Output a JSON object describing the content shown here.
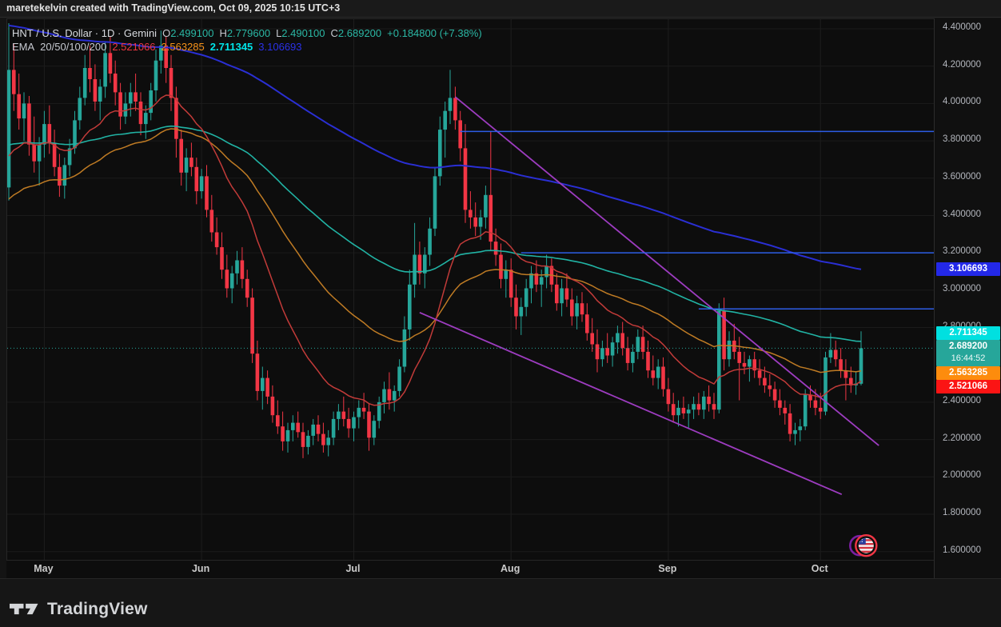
{
  "topbar": {
    "text": "maretekelvin created with TradingView.com, Oct 09, 2025 10:15 UTC+3"
  },
  "legend": {
    "symbol": "HNT / U.S. Dollar · 1D · Gemini",
    "ohlc": [
      {
        "label": "O",
        "value": "2.499100"
      },
      {
        "label": "H",
        "value": "2.779600"
      },
      {
        "label": "L",
        "value": "2.490100"
      },
      {
        "label": "C",
        "value": "2.689200"
      }
    ],
    "change": "+0.184800 (+7.38%)",
    "ema_label": "EMA",
    "ema_periods": "20/50/100/200",
    "ema_values": [
      {
        "text": "2.521066",
        "color": "#ef3742"
      },
      {
        "text": "2.563285",
        "color": "#f7931a"
      },
      {
        "text": "2.711345",
        "color": "#00e5e9"
      },
      {
        "text": "3.106693",
        "color": "#2a31e8"
      }
    ]
  },
  "colors": {
    "up": "#26a69a",
    "down": "#f23645",
    "ohlc_value": "#2bb8a5",
    "grid": "#1b1b1b",
    "vgrid": "#1d1d1d",
    "hline_blue": "#2f62f2",
    "trend_purple": "#9d3cc0",
    "close_dotted": "#26a69a",
    "ema20": "#c23b39",
    "ema50": "#bf7b24",
    "ema100": "#21b3a4",
    "ema200": "#2a2fd4"
  },
  "chart_data": {
    "type": "candlestick",
    "title": "HNT / U.S. Dollar · 1D · Gemini",
    "interval": "1D",
    "exchange": "Gemini",
    "x_months": [
      {
        "label": "May",
        "day": 7
      },
      {
        "label": "Jun",
        "day": 38
      },
      {
        "label": "Jul",
        "day": 68
      },
      {
        "label": "Aug",
        "day": 99
      },
      {
        "label": "Sep",
        "day": 130
      },
      {
        "label": "Oct",
        "day": 160
      }
    ],
    "y_ticks": [
      {
        "label": "4.400000",
        "price": 4.4
      },
      {
        "label": "4.200000",
        "price": 4.2
      },
      {
        "label": "4.000000",
        "price": 4.0
      },
      {
        "label": "3.800000",
        "price": 3.8
      },
      {
        "label": "3.600000",
        "price": 3.6
      },
      {
        "label": "3.400000",
        "price": 3.4
      },
      {
        "label": "3.200000",
        "price": 3.2
      },
      {
        "label": "3.000000",
        "price": 3.0
      },
      {
        "label": "2.800000",
        "price": 2.8
      },
      {
        "label": "2.400000",
        "price": 2.4
      },
      {
        "label": "2.200000",
        "price": 2.2
      },
      {
        "label": "2.000000",
        "price": 2.0
      },
      {
        "label": "1.800000",
        "price": 1.8
      },
      {
        "label": "1.600000",
        "price": 1.6
      }
    ],
    "ylim": [
      1.6,
      4.4
    ],
    "candles": [
      [
        3.55,
        4.43,
        3.48,
        4.18
      ],
      [
        4.18,
        4.32,
        3.96,
        4.05
      ],
      [
        4.05,
        4.16,
        3.86,
        3.92
      ],
      [
        3.92,
        4.06,
        3.8,
        4.0
      ],
      [
        4.0,
        4.04,
        3.72,
        3.78
      ],
      [
        3.78,
        3.93,
        3.63,
        3.69
      ],
      [
        3.69,
        3.82,
        3.56,
        3.78
      ],
      [
        3.78,
        3.96,
        3.71,
        3.89
      ],
      [
        3.89,
        3.99,
        3.73,
        3.79
      ],
      [
        3.79,
        3.86,
        3.61,
        3.66
      ],
      [
        3.66,
        3.73,
        3.5,
        3.56
      ],
      [
        3.56,
        3.71,
        3.49,
        3.67
      ],
      [
        3.67,
        3.81,
        3.61,
        3.76
      ],
      [
        3.76,
        3.96,
        3.73,
        3.91
      ],
      [
        3.91,
        4.09,
        3.86,
        4.03
      ],
      [
        4.03,
        4.26,
        3.99,
        4.19
      ],
      [
        4.19,
        4.31,
        4.06,
        4.13
      ],
      [
        4.13,
        4.21,
        3.96,
        4.01
      ],
      [
        4.01,
        4.13,
        3.91,
        4.09
      ],
      [
        4.09,
        4.33,
        4.03,
        4.27
      ],
      [
        4.27,
        4.36,
        4.11,
        4.16
      ],
      [
        4.16,
        4.23,
        3.99,
        4.06
      ],
      [
        4.06,
        4.11,
        3.86,
        3.93
      ],
      [
        3.93,
        4.06,
        3.89,
        4.0
      ],
      [
        4.0,
        4.11,
        3.93,
        4.06
      ],
      [
        4.06,
        4.16,
        3.96,
        4.01
      ],
      [
        4.01,
        4.06,
        3.83,
        3.89
      ],
      [
        3.89,
        3.99,
        3.81,
        3.95
      ],
      [
        3.95,
        4.11,
        3.91,
        4.07
      ],
      [
        4.07,
        4.29,
        4.01,
        4.23
      ],
      [
        4.23,
        4.39,
        4.16,
        4.31
      ],
      [
        4.31,
        4.36,
        4.11,
        4.19
      ],
      [
        4.19,
        4.26,
        3.96,
        4.03
      ],
      [
        4.03,
        4.09,
        3.71,
        3.81
      ],
      [
        3.81,
        3.86,
        3.56,
        3.63
      ],
      [
        3.63,
        3.76,
        3.53,
        3.71
      ],
      [
        3.71,
        3.79,
        3.61,
        3.66
      ],
      [
        3.66,
        3.71,
        3.46,
        3.53
      ],
      [
        3.53,
        3.65,
        3.49,
        3.61
      ],
      [
        3.61,
        3.67,
        3.39,
        3.43
      ],
      [
        3.43,
        3.51,
        3.26,
        3.31
      ],
      [
        3.31,
        3.39,
        3.19,
        3.23
      ],
      [
        3.23,
        3.31,
        3.06,
        3.11
      ],
      [
        3.11,
        3.19,
        2.96,
        3.01
      ],
      [
        3.01,
        3.13,
        2.93,
        3.09
      ],
      [
        3.09,
        3.21,
        3.03,
        3.16
      ],
      [
        3.16,
        3.23,
        3.01,
        3.06
      ],
      [
        3.06,
        3.11,
        2.91,
        2.96
      ],
      [
        2.96,
        3.01,
        2.61,
        2.66
      ],
      [
        2.66,
        2.73,
        2.41,
        2.46
      ],
      [
        2.46,
        2.59,
        2.36,
        2.53
      ],
      [
        2.53,
        2.57,
        2.39,
        2.43
      ],
      [
        2.43,
        2.49,
        2.29,
        2.33
      ],
      [
        2.33,
        2.41,
        2.23,
        2.27
      ],
      [
        2.27,
        2.35,
        2.14,
        2.19
      ],
      [
        2.19,
        2.29,
        2.13,
        2.25
      ],
      [
        2.25,
        2.33,
        2.19,
        2.29
      ],
      [
        2.29,
        2.35,
        2.21,
        2.24
      ],
      [
        2.24,
        2.29,
        2.1,
        2.16
      ],
      [
        2.16,
        2.25,
        2.12,
        2.22
      ],
      [
        2.22,
        2.31,
        2.17,
        2.28
      ],
      [
        2.28,
        2.33,
        2.19,
        2.23
      ],
      [
        2.23,
        2.29,
        2.13,
        2.17
      ],
      [
        2.17,
        2.25,
        2.11,
        2.21
      ],
      [
        2.21,
        2.35,
        2.17,
        2.31
      ],
      [
        2.31,
        2.39,
        2.25,
        2.35
      ],
      [
        2.35,
        2.43,
        2.27,
        2.31
      ],
      [
        2.31,
        2.37,
        2.21,
        2.26
      ],
      [
        2.26,
        2.35,
        2.19,
        2.32
      ],
      [
        2.32,
        2.41,
        2.26,
        2.37
      ],
      [
        2.37,
        2.45,
        2.31,
        2.35
      ],
      [
        2.35,
        2.39,
        2.14,
        2.21
      ],
      [
        2.21,
        2.33,
        2.17,
        2.3
      ],
      [
        2.3,
        2.43,
        2.26,
        2.4
      ],
      [
        2.4,
        2.51,
        2.34,
        2.47
      ],
      [
        2.47,
        2.56,
        2.36,
        2.41
      ],
      [
        2.41,
        2.49,
        2.35,
        2.46
      ],
      [
        2.46,
        2.63,
        2.43,
        2.59
      ],
      [
        2.59,
        2.86,
        2.56,
        2.79
      ],
      [
        2.79,
        3.11,
        2.73,
        3.03
      ],
      [
        3.03,
        3.36,
        2.96,
        3.19
      ],
      [
        3.19,
        3.26,
        3.03,
        3.09
      ],
      [
        3.09,
        3.23,
        3.01,
        3.19
      ],
      [
        3.19,
        3.39,
        3.13,
        3.33
      ],
      [
        3.33,
        3.66,
        3.29,
        3.61
      ],
      [
        3.61,
        3.93,
        3.56,
        3.86
      ],
      [
        3.86,
        4.01,
        3.71,
        3.96
      ],
      [
        3.96,
        4.18,
        3.89,
        4.03
      ],
      [
        4.03,
        4.09,
        3.86,
        3.91
      ],
      [
        3.91,
        3.96,
        3.69,
        3.76
      ],
      [
        3.76,
        3.89,
        3.36,
        3.43
      ],
      [
        3.43,
        3.53,
        3.33,
        3.39
      ],
      [
        3.39,
        3.47,
        3.29,
        3.34
      ],
      [
        3.34,
        3.43,
        3.27,
        3.39
      ],
      [
        3.39,
        3.56,
        3.33,
        3.51
      ],
      [
        3.51,
        3.85,
        3.21,
        3.26
      ],
      [
        3.26,
        3.33,
        3.13,
        3.19
      ],
      [
        3.19,
        3.25,
        3.01,
        3.06
      ],
      [
        3.06,
        3.16,
        2.96,
        3.11
      ],
      [
        3.11,
        3.17,
        2.91,
        2.96
      ],
      [
        2.96,
        3.03,
        2.79,
        2.86
      ],
      [
        2.86,
        2.96,
        2.76,
        2.91
      ],
      [
        2.91,
        3.06,
        2.86,
        3.01
      ],
      [
        3.01,
        3.13,
        2.93,
        3.09
      ],
      [
        3.09,
        3.16,
        2.99,
        3.03
      ],
      [
        3.03,
        3.11,
        2.91,
        3.07
      ],
      [
        3.07,
        3.19,
        3.01,
        3.13
      ],
      [
        3.13,
        3.17,
        2.99,
        3.03
      ],
      [
        3.03,
        3.09,
        2.89,
        2.93
      ],
      [
        2.93,
        3.06,
        2.86,
        3.01
      ],
      [
        3.01,
        3.09,
        2.91,
        2.95
      ],
      [
        2.95,
        3.01,
        2.81,
        2.86
      ],
      [
        2.86,
        2.97,
        2.79,
        2.93
      ],
      [
        2.93,
        2.99,
        2.83,
        2.87
      ],
      [
        2.87,
        2.93,
        2.73,
        2.77
      ],
      [
        2.77,
        2.85,
        2.67,
        2.71
      ],
      [
        2.71,
        2.79,
        2.56,
        2.63
      ],
      [
        2.63,
        2.73,
        2.59,
        2.69
      ],
      [
        2.69,
        2.77,
        2.61,
        2.65
      ],
      [
        2.65,
        2.75,
        2.59,
        2.72
      ],
      [
        2.72,
        2.81,
        2.66,
        2.77
      ],
      [
        2.77,
        2.83,
        2.65,
        2.69
      ],
      [
        2.69,
        2.75,
        2.57,
        2.61
      ],
      [
        2.61,
        2.71,
        2.56,
        2.67
      ],
      [
        2.67,
        2.79,
        2.63,
        2.75
      ],
      [
        2.75,
        2.81,
        2.63,
        2.67
      ],
      [
        2.67,
        2.73,
        2.53,
        2.57
      ],
      [
        2.57,
        2.65,
        2.49,
        2.53
      ],
      [
        2.53,
        2.63,
        2.47,
        2.59
      ],
      [
        2.59,
        2.64,
        2.43,
        2.47
      ],
      [
        2.47,
        2.53,
        2.35,
        2.39
      ],
      [
        2.39,
        2.45,
        2.29,
        2.33
      ],
      [
        2.33,
        2.41,
        2.27,
        2.37
      ],
      [
        2.37,
        2.43,
        2.31,
        2.34
      ],
      [
        2.34,
        2.39,
        2.26,
        2.36
      ],
      [
        2.36,
        2.43,
        2.31,
        2.39
      ],
      [
        2.39,
        2.45,
        2.33,
        2.36
      ],
      [
        2.36,
        2.46,
        2.31,
        2.43
      ],
      [
        2.43,
        2.49,
        2.35,
        2.39
      ],
      [
        2.39,
        2.45,
        2.31,
        2.36
      ],
      [
        2.36,
        2.93,
        2.34,
        2.89
      ],
      [
        2.89,
        2.96,
        2.57,
        2.63
      ],
      [
        2.63,
        2.78,
        2.59,
        2.73
      ],
      [
        2.73,
        2.82,
        2.63,
        2.67
      ],
      [
        2.67,
        2.75,
        2.41,
        2.61
      ],
      [
        2.61,
        2.67,
        2.55,
        2.59
      ],
      [
        2.59,
        2.65,
        2.51,
        2.63
      ],
      [
        2.63,
        2.67,
        2.53,
        2.57
      ],
      [
        2.57,
        2.63,
        2.49,
        2.53
      ],
      [
        2.53,
        2.59,
        2.45,
        2.49
      ],
      [
        2.49,
        2.55,
        2.43,
        2.47
      ],
      [
        2.47,
        2.51,
        2.37,
        2.41
      ],
      [
        2.41,
        2.47,
        2.33,
        2.37
      ],
      [
        2.37,
        2.41,
        2.28,
        2.34
      ],
      [
        2.34,
        2.39,
        2.19,
        2.23
      ],
      [
        2.23,
        2.29,
        2.17,
        2.25
      ],
      [
        2.25,
        2.31,
        2.19,
        2.27
      ],
      [
        2.27,
        2.47,
        2.25,
        2.44
      ],
      [
        2.44,
        2.49,
        2.37,
        2.41
      ],
      [
        2.41,
        2.47,
        2.33,
        2.37
      ],
      [
        2.37,
        2.45,
        2.31,
        2.35
      ],
      [
        2.35,
        2.67,
        2.33,
        2.64
      ],
      [
        2.64,
        2.77,
        2.61,
        2.68
      ],
      [
        2.68,
        2.73,
        2.59,
        2.63
      ],
      [
        2.63,
        2.69,
        2.53,
        2.57
      ],
      [
        2.57,
        2.63,
        2.41,
        2.53
      ],
      [
        2.53,
        2.59,
        2.45,
        2.49
      ],
      [
        2.49,
        2.56,
        2.44,
        2.5
      ],
      [
        2.4991,
        2.7796,
        2.4901,
        2.6892
      ]
    ],
    "emas": [
      {
        "period": 20,
        "seed": 3.67,
        "color_key": "ema20",
        "width": 1.5,
        "legend": "2.521066"
      },
      {
        "period": 50,
        "seed": 3.46,
        "color_key": "ema50",
        "width": 1.5,
        "legend": "2.563285"
      },
      {
        "period": 100,
        "seed": 3.77,
        "color_key": "ema100",
        "width": 1.6,
        "legend": "2.711345"
      },
      {
        "period": 200,
        "seed": 4.42,
        "color_key": "ema200",
        "width": 2.0,
        "legend": "3.106693"
      }
    ],
    "trendlines": [
      {
        "from_day": 88,
        "from_price": 4.035,
        "to_day": 171.5,
        "to_price": 2.168
      },
      {
        "from_day": 81,
        "from_price": 2.88,
        "to_day": 164.2,
        "to_price": 1.906
      }
    ],
    "hlines": [
      {
        "price": 3.85,
        "from_day": 89
      },
      {
        "price": 3.2,
        "from_day": 101
      },
      {
        "price": 2.9,
        "from_day": 136
      }
    ],
    "close_line": {
      "price": 2.6892
    },
    "marker": {
      "day": 169,
      "price": 1.632,
      "type": "us-flag-badge"
    }
  },
  "price_axis": {
    "badges": [
      {
        "text": "3.106693",
        "price": 3.106693,
        "bg": "#2328e8"
      },
      {
        "text": "2.711345",
        "price": 2.711345,
        "bg": "#00e0e0"
      },
      {
        "text": "2.689200",
        "sub": "16:44:52",
        "price": 2.6892,
        "bg": "#26a69a"
      },
      {
        "text": "2.563285",
        "price": 2.563285,
        "bg": "#fd8c0d"
      },
      {
        "text": "2.521066",
        "price": 2.521066,
        "bg": "#fb1414"
      }
    ]
  },
  "footer": {
    "brand": "TradingView"
  }
}
